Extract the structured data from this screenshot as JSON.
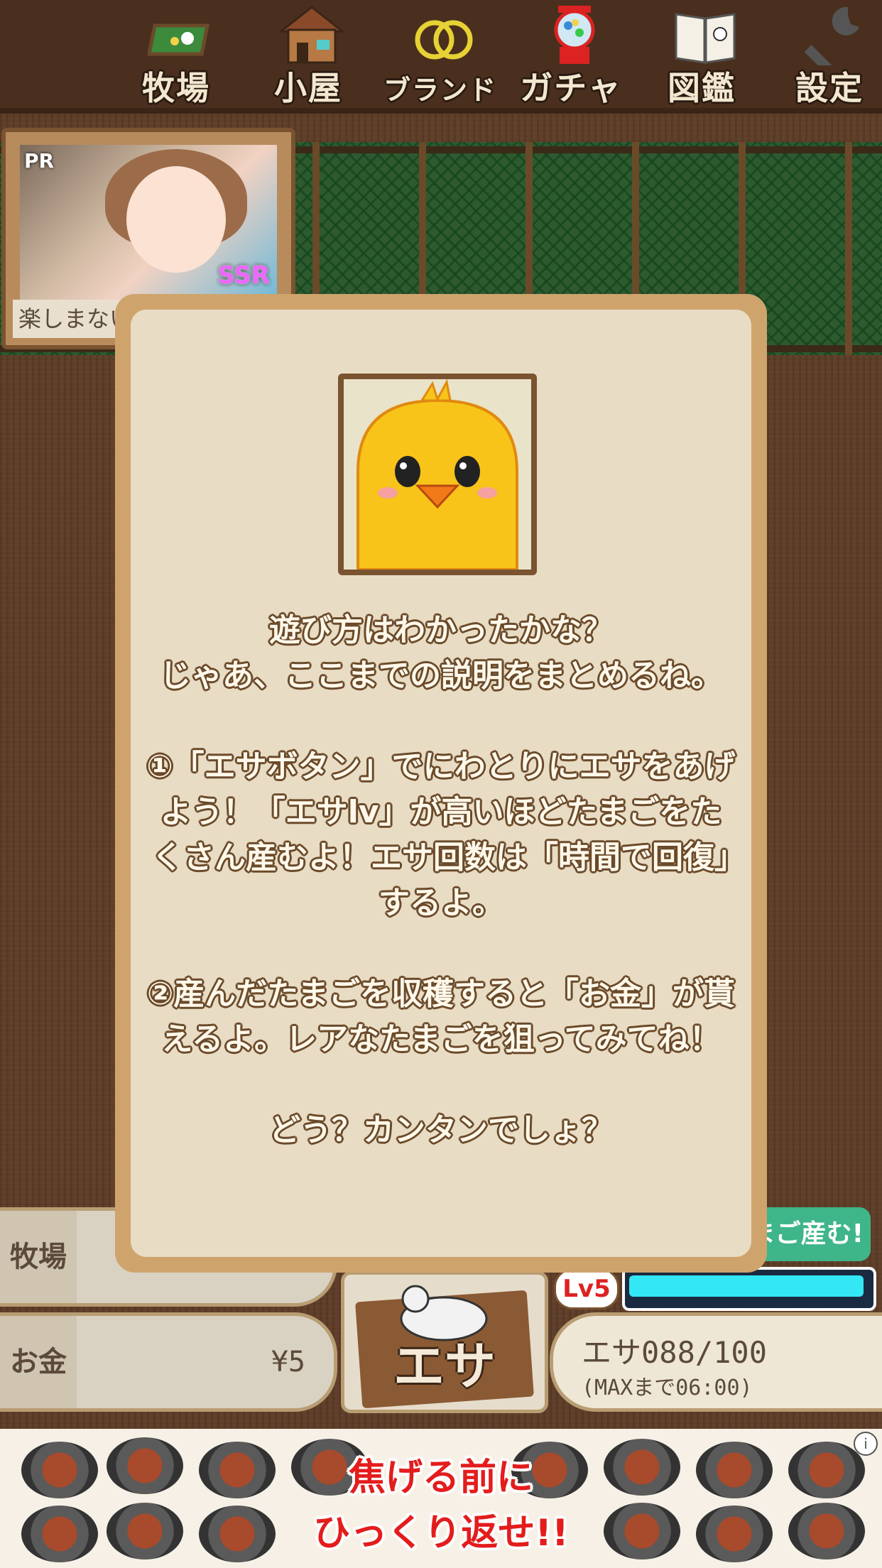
{
  "nav": {
    "items": [
      {
        "label": "牧場",
        "icon": "ranch-icon"
      },
      {
        "label": "小屋",
        "icon": "barn-icon"
      },
      {
        "label": "ブランド",
        "icon": "brand-rings-icon"
      },
      {
        "label": "ガチャ",
        "icon": "gacha-machine-icon"
      },
      {
        "label": "図鑑",
        "icon": "book-icon"
      },
      {
        "label": "設定",
        "icon": "wrench-icon"
      }
    ]
  },
  "pr_ad": {
    "tag": "PR",
    "badge": "SSR",
    "text": "楽しまない"
  },
  "dialog": {
    "text": "遊び方はわかったかな？\nじゃあ、ここまでの説明をまとめるね。\n\n①「エサボタン」でにわとりにエサをあげよう！「エサlv」が高いほどたまごをたくさん産むよ！エサ回数は「時間で回復」するよ。\n\n②産んだたまごを収穫すると「お金」が貰えるよ。レアなたまごを狙ってみてね！\n\nどう？カンタンでしょ？"
  },
  "status": {
    "ranch_label": "牧場",
    "ranch_value": "",
    "money_label": "お金",
    "money_value": "¥5"
  },
  "feed": {
    "button_label": "エサ",
    "lv_badge": "Lv5",
    "lv_progress": 1.0,
    "count": "エサ088/100",
    "recover": "(MAXまで06:00)",
    "egg_button": "まご産む!"
  },
  "ad": {
    "line1": "焦げる前に",
    "line2": "ひっくり返せ!!",
    "info": "i"
  },
  "colors": {
    "modal_border": "#cfa46c",
    "modal_bg": "#e8dcc4",
    "egg_button": "#3fb58a",
    "lv_bar": "#33e8f4"
  }
}
